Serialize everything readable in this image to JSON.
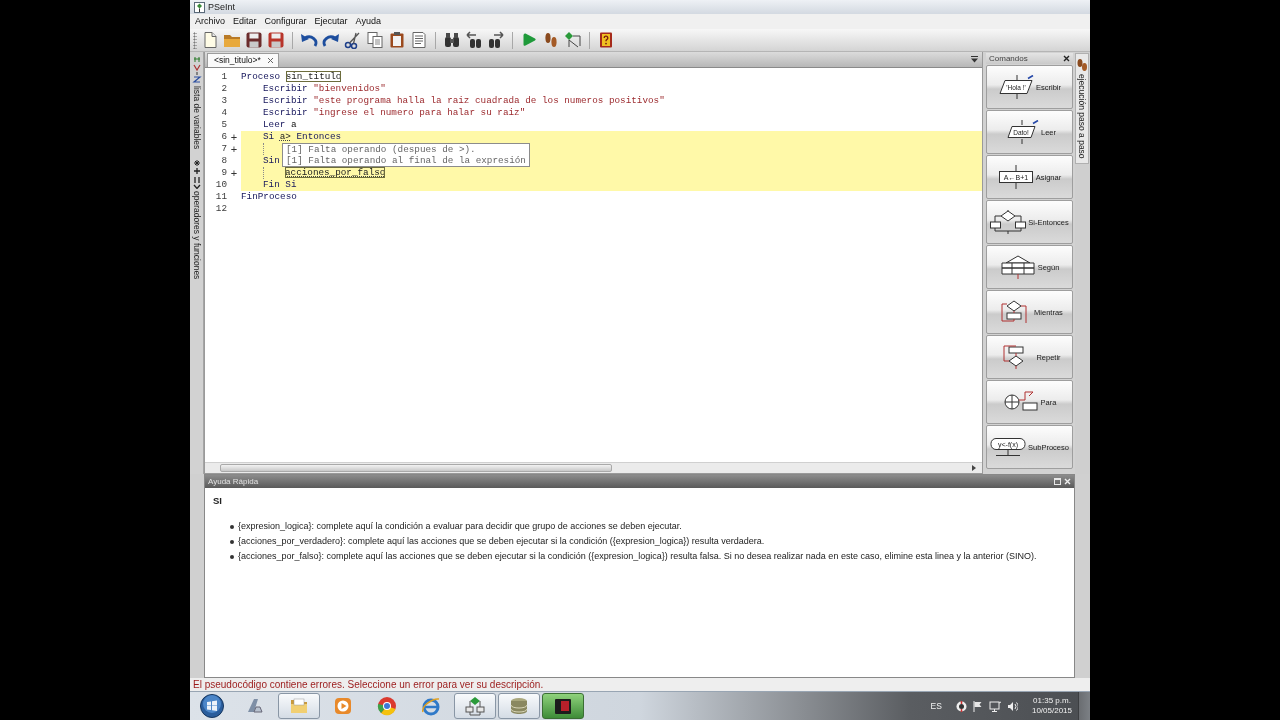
{
  "window": {
    "title": "PSeInt"
  },
  "menu": [
    {
      "label": "Archivo"
    },
    {
      "label": "Editar"
    },
    {
      "label": "Configurar"
    },
    {
      "label": "Ejecutar"
    },
    {
      "label": "Ayuda"
    }
  ],
  "left_tabs": [
    {
      "label": "lista de variables",
      "kind": "variables"
    },
    {
      "label": "operadores y funciones",
      "kind": "operators"
    }
  ],
  "editor": {
    "tabs": [
      {
        "label": "<sin_titulo>*",
        "selected": true
      }
    ],
    "lines": [
      {
        "number": "1",
        "highlighted": false,
        "tokens": [
          {
            "kind": "keyword",
            "text": "Proceso"
          },
          {
            "kind": "slot",
            "text": "sin_titulo"
          }
        ],
        "children": [
          {
            "number": "2",
            "highlighted": false,
            "tokens": [
              {
                "kind": "keyword",
                "text": "Escribir"
              },
              {
                "kind": "string",
                "text": "\"bienvenidos\""
              }
            ]
          },
          {
            "number": "3",
            "highlighted": false,
            "tokens": [
              {
                "kind": "keyword",
                "text": "Escribir"
              },
              {
                "kind": "string",
                "text": "\"este programa halla la raiz cuadrada de los numeros positivos\""
              }
            ]
          },
          {
            "number": "4",
            "highlighted": false,
            "tokens": [
              {
                "kind": "keyword",
                "text": "Escribir"
              },
              {
                "kind": "string",
                "text": "\"ingrese el numero para halar su raiz\""
              }
            ]
          },
          {
            "number": "5",
            "highlighted": false,
            "tokens": [
              {
                "kind": "keyword",
                "text": "Leer"
              },
              {
                "kind": "ident",
                "text": "a"
              }
            ]
          },
          {
            "number": "6",
            "marker": "+",
            "highlighted": true,
            "tokens": [
              {
                "kind": "keyword",
                "text": "Si"
              },
              {
                "kind": "error",
                "text": "a>"
              },
              {
                "kind": "keyword",
                "text": "Entonces"
              }
            ],
            "children": [
              {
                "number": "7",
                "marker": "+",
                "highlighted": true,
                "tooltip": [
                  "[1] Falta operando (despues de >).",
                  "[1] Falta operando al final de la expresión"
                ]
              }
            ]
          },
          {
            "number": "8",
            "highlighted": true,
            "tokens": [
              {
                "kind": "keyword",
                "text": "Sin"
              }
            ],
            "children": [
              {
                "number": "9",
                "marker": "+",
                "highlighted": true,
                "tokens": [
                  {
                    "kind": "errslot",
                    "text": "acciones_por_falso"
                  }
                ]
              }
            ]
          },
          {
            "number": "10",
            "highlighted": true,
            "tokens": [
              {
                "kind": "keyword",
                "text": "Fin Si"
              }
            ]
          }
        ]
      },
      {
        "number": "11",
        "highlighted": false,
        "tokens": [
          {
            "kind": "keyword",
            "text": "FinProceso"
          }
        ]
      },
      {
        "number": "12",
        "highlighted": false
      }
    ]
  },
  "commands": {
    "title": "Comandos",
    "items": [
      {
        "label": "Escribir",
        "kind": "output",
        "icon_text": "'Hola !'"
      },
      {
        "label": "Leer",
        "kind": "input",
        "icon_text": "Dato!"
      },
      {
        "label": "Asignar",
        "kind": "assign",
        "icon_text": "A←B+1"
      },
      {
        "label": "Si-Entonces",
        "kind": "if"
      },
      {
        "label": "Según",
        "kind": "switch"
      },
      {
        "label": "Mientras",
        "kind": "while"
      },
      {
        "label": "Repetir",
        "kind": "repeat"
      },
      {
        "label": "Para",
        "kind": "for"
      },
      {
        "label": "SubProceso",
        "kind": "function",
        "icon_text": "y<-f(x)"
      }
    ]
  },
  "right_tabs": [
    {
      "label": "ejecución paso a paso"
    }
  ],
  "help": {
    "title": "Ayuda Rápida",
    "heading": "SI",
    "bullets": [
      "{expresion_logica}: complete aquí la condición a evaluar para decidir que grupo de acciones se deben ejecutar.",
      "{acciones_por_verdadero}: complete aquí las acciones que se deben ejecutar si la condición ({expresion_logica}) resulta verdadera.",
      "{acciones_por_falso}: complete aquí las acciones que se deben ejecutar si la condición ({expresion_logica}) resulta falsa. Si no desea realizar nada en este caso, elimine esta linea y la anterior (SINO)."
    ]
  },
  "status": "El pseudocódigo contiene errores. Seleccione un error para ver su descripción.",
  "taskbar": {
    "apps": [
      {
        "kind": "device",
        "running": false,
        "selected": false
      },
      {
        "kind": "folder",
        "running": true,
        "selected": false
      },
      {
        "kind": "player",
        "running": false,
        "selected": false
      },
      {
        "kind": "browser",
        "running": false,
        "selected": false
      },
      {
        "kind": "explorer",
        "running": false,
        "selected": false
      },
      {
        "kind": "flowchart",
        "running": true,
        "selected": false
      },
      {
        "kind": "archive",
        "running": true,
        "selected": false
      },
      {
        "kind": "app",
        "running": true,
        "selected": true
      }
    ],
    "language": "ES",
    "time": "01:35 p.m.",
    "date": "10/05/2015"
  }
}
